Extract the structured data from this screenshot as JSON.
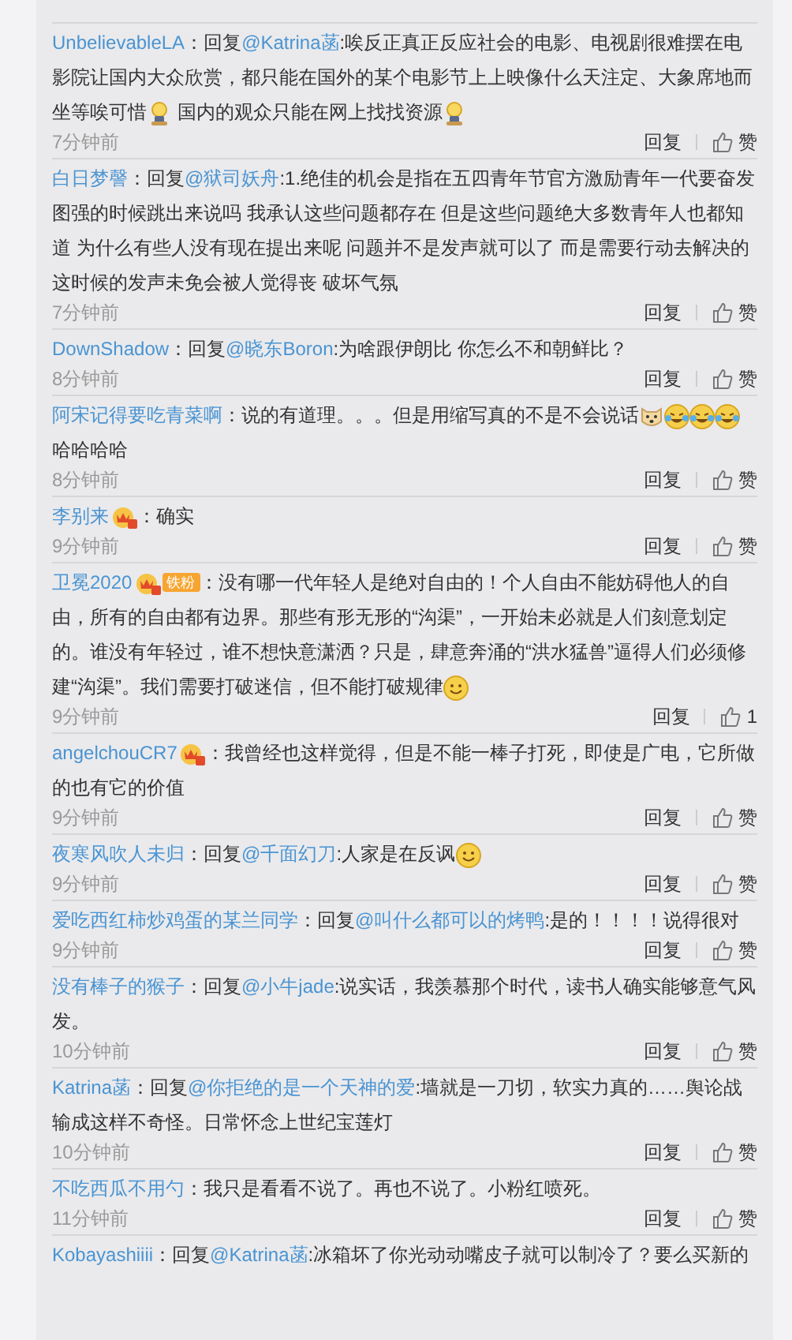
{
  "comments": [
    {
      "user": "UnbelievableLA",
      "body": [
        {
          "kind": "text",
          "text": "：回复"
        },
        {
          "kind": "mention",
          "text": "@Katrina菡"
        },
        {
          "kind": "text",
          "text": ":唉反正真正反应社会的电影、电视剧很难摆在电影院让国内大众欣赏，都只能在国外的某个电影节上上映像什么天注定、大象席地而坐等唉可惜"
        },
        {
          "kind": "figure"
        },
        {
          "kind": "text",
          "text": " 国内的观众只能在网上找找资源"
        },
        {
          "kind": "figure"
        }
      ],
      "time": "7分钟前",
      "reply": "回复",
      "like": "赞"
    },
    {
      "user": "白日梦謦",
      "body": [
        {
          "kind": "text",
          "text": "：回复"
        },
        {
          "kind": "mention",
          "text": "@狱司妖舟"
        },
        {
          "kind": "text",
          "text": ":1.绝佳的机会是指在五四青年节官方激励青年一代要奋发图强的时候跳出来说吗 我承认这些问题都存在 但是这些问题绝大多数青年人也都知道 为什么有些人没有现在提出来呢 问题并不是发声就可以了 而是需要行动去解决的这时候的发声未免会被人觉得丧 破坏气氛"
        }
      ],
      "time": "7分钟前",
      "reply": "回复",
      "like": "赞"
    },
    {
      "user": "DownShadow",
      "body": [
        {
          "kind": "text",
          "text": "：回复"
        },
        {
          "kind": "mention",
          "text": "@晓东Boron"
        },
        {
          "kind": "text",
          "text": ":为啥跟伊朗比 你怎么不和朝鲜比？"
        }
      ],
      "time": "8分钟前",
      "reply": "回复",
      "like": "赞"
    },
    {
      "user": "阿宋记得要吃青菜啊",
      "body": [
        {
          "kind": "text",
          "text": "：说的有道理。。。但是用缩写真的不是不会说话"
        },
        {
          "kind": "dog"
        },
        {
          "kind": "cry"
        },
        {
          "kind": "cry"
        },
        {
          "kind": "cry"
        },
        {
          "kind": "text",
          "text": "哈哈哈哈"
        }
      ],
      "time": "8分钟前",
      "reply": "回复",
      "like": "赞"
    },
    {
      "user": "李别来",
      "badges": [
        {
          "kind": "vip"
        }
      ],
      "body": [
        {
          "kind": "text",
          "text": "：确实"
        }
      ],
      "time": "9分钟前",
      "reply": "回复",
      "like": "赞"
    },
    {
      "user": "卫冕2020",
      "badges": [
        {
          "kind": "vip"
        },
        {
          "kind": "fan",
          "text": "铁粉"
        }
      ],
      "body": [
        {
          "kind": "text",
          "text": "：没有哪一代年轻人是绝对自由的！个人自由不能妨碍他人的自由，所有的自由都有边界。那些有形无形的“沟渠”，一开始未必就是人们刻意划定的。谁没有年轻过，谁不想快意潇洒？只是，肆意奔涌的“洪水猛兽”逼得人们必须修建“沟渠”。我们需要打破迷信，但不能打破规律"
        },
        {
          "kind": "smile"
        }
      ],
      "time": "9分钟前",
      "reply": "回复",
      "like": "1"
    },
    {
      "user": "angelchouCR7",
      "badges": [
        {
          "kind": "vip"
        }
      ],
      "body": [
        {
          "kind": "text",
          "text": "：我曾经也这样觉得，但是不能一棒子打死，即使是广电，它所做的也有它的价值"
        }
      ],
      "time": "9分钟前",
      "reply": "回复",
      "like": "赞"
    },
    {
      "user": "夜寒风吹人未归",
      "body": [
        {
          "kind": "text",
          "text": "：回复"
        },
        {
          "kind": "mention",
          "text": "@千面幻刀"
        },
        {
          "kind": "text",
          "text": ":人家是在反讽"
        },
        {
          "kind": "smile"
        }
      ],
      "time": "9分钟前",
      "reply": "回复",
      "like": "赞"
    },
    {
      "user": "爱吃西红柿炒鸡蛋的某兰同学",
      "body": [
        {
          "kind": "text",
          "text": "：回复"
        },
        {
          "kind": "mention",
          "text": "@叫什么都可以的烤鸭"
        },
        {
          "kind": "text",
          "text": ":是的！！！！说得很对"
        }
      ],
      "time": "9分钟前",
      "reply": "回复",
      "like": "赞"
    },
    {
      "user": "没有棒子的猴子",
      "body": [
        {
          "kind": "text",
          "text": "：回复"
        },
        {
          "kind": "mention",
          "text": "@小牛jade"
        },
        {
          "kind": "text",
          "text": ":说实话，我羡慕那个时代，读书人确实能够意气风发。"
        }
      ],
      "time": "10分钟前",
      "reply": "回复",
      "like": "赞"
    },
    {
      "user": "Katrina菡",
      "body": [
        {
          "kind": "text",
          "text": "：回复"
        },
        {
          "kind": "mention",
          "text": "@你拒绝的是一个天神的爱"
        },
        {
          "kind": "text",
          "text": ":墙就是一刀切，软实力真的……舆论战输成这样不奇怪。日常怀念上世纪宝莲灯"
        }
      ],
      "time": "10分钟前",
      "reply": "回复",
      "like": "赞"
    },
    {
      "user": "不吃西瓜不用勺",
      "body": [
        {
          "kind": "text",
          "text": "：我只是看看不说了。再也不说了。小粉红喷死。"
        }
      ],
      "time": "11分钟前",
      "reply": "回复",
      "like": "赞"
    },
    {
      "user": "Kobayashiiii",
      "body": [
        {
          "kind": "text",
          "text": "：回复"
        },
        {
          "kind": "mention",
          "text": "@Katrina菡"
        },
        {
          "kind": "text",
          "text": ":冰箱坏了你光动动嘴皮子就可以制冷了？要么买新的"
        }
      ]
    }
  ]
}
